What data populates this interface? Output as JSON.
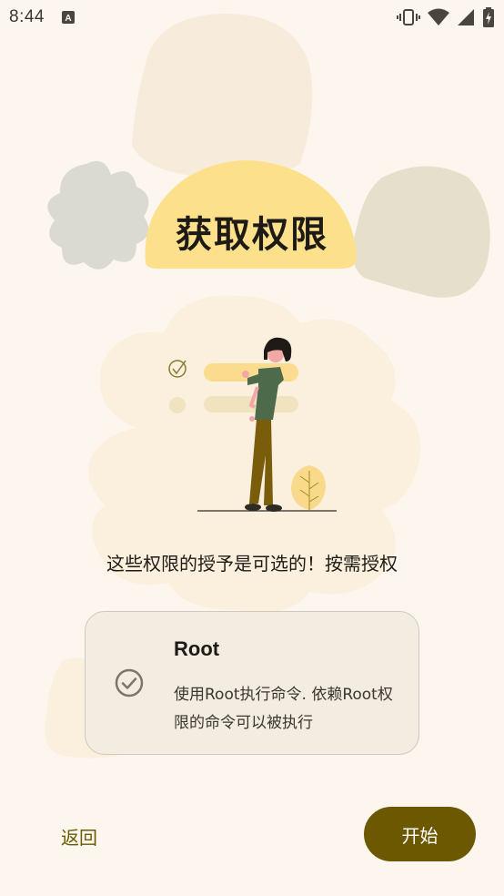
{
  "status_bar": {
    "time": "8:44",
    "icons": [
      "keyboard-a-icon",
      "vibrate-icon",
      "wifi-icon",
      "cell-signal-icon",
      "battery-charging-icon"
    ]
  },
  "page": {
    "title": "获取权限",
    "subtitle": "这些权限的授予是可选的！按需授权"
  },
  "permissions": [
    {
      "title": "Root",
      "description": "使用Root执行命令. 依赖Root权限的命令可以被执行",
      "granted": true
    }
  ],
  "actions": {
    "back_label": "返回",
    "start_label": "开始"
  },
  "colors": {
    "background": "#fdf6ee",
    "primary": "#6b5800",
    "title_blob": "#fde08c",
    "card_bg": "#f3ece1"
  }
}
